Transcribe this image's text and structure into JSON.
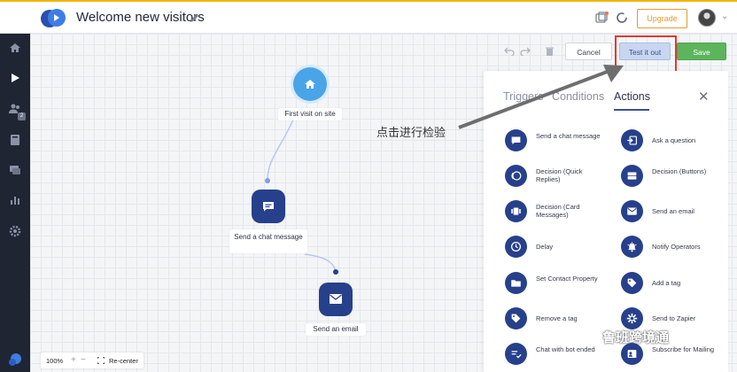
{
  "header": {
    "title": "Welcome new visitors",
    "upgrade_label": "Upgrade",
    "more": "⌄"
  },
  "sidebar": {
    "badge": "2"
  },
  "toolbar": {
    "cancel_label": "Cancel",
    "test_label": "Test it out",
    "save_label": "Save"
  },
  "flow": {
    "nodes": [
      {
        "label": "First visit on site"
      },
      {
        "label": "Send a chat message"
      },
      {
        "label": "Send an email"
      }
    ]
  },
  "panel": {
    "tabs": [
      "Triggers",
      "Conditions",
      "Actions"
    ],
    "actions": [
      {
        "label": "Send a chat message",
        "icon": "chat-icon"
      },
      {
        "label": "Ask a question",
        "icon": "question-icon"
      },
      {
        "label": "Decision (Quick Replies)",
        "icon": "quick-replies-icon"
      },
      {
        "label": "Decision (Buttons)",
        "icon": "buttons-icon"
      },
      {
        "label": "Decision (Card Messages)",
        "icon": "card-messages-icon"
      },
      {
        "label": "Send an email",
        "icon": "email-icon"
      },
      {
        "label": "Delay",
        "icon": "clock-icon"
      },
      {
        "label": "Notify Operators",
        "icon": "bell-icon"
      },
      {
        "label": "Set Contact Property",
        "icon": "folder-icon"
      },
      {
        "label": "Add a tag",
        "icon": "tag-icon"
      },
      {
        "label": "Remove a tag",
        "icon": "tag-remove-icon"
      },
      {
        "label": "Send to Zapier",
        "icon": "zapier-icon"
      },
      {
        "label": "Chat with bot ended",
        "icon": "bot-ended-icon"
      },
      {
        "label": "Subscribe for Mailing",
        "icon": "subscribe-icon"
      }
    ]
  },
  "annotation": {
    "text": "点击进行检验"
  },
  "zoom": {
    "level": "100%",
    "plus": "+",
    "minus": "−",
    "recenter": "Re-center"
  },
  "watermark": {
    "text": "鲁班跨境通"
  },
  "colors": {
    "accent": "#27408b",
    "save": "#5cb55c",
    "upgrade": "#e39b2c",
    "highlight": "#e03a2f"
  }
}
